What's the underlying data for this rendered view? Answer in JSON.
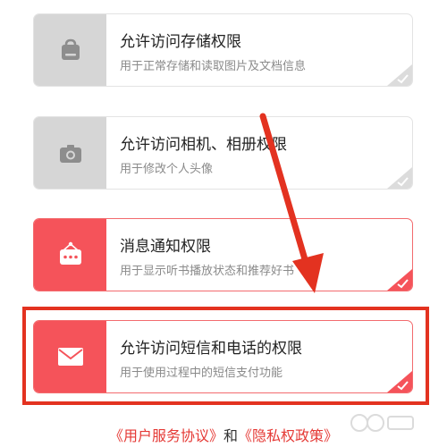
{
  "permissions": [
    {
      "title": "允许访问存储权限",
      "desc": "用于正常存储和读取图片及文档信息",
      "icon": "storage-icon",
      "active": false
    },
    {
      "title": "允许访问相机、相册权限",
      "desc": "用于修改个人头像",
      "icon": "camera-icon",
      "active": false
    },
    {
      "title": "消息通知权限",
      "desc": "用于显示听书播放状态和推荐好书",
      "icon": "notification-icon",
      "active": true
    },
    {
      "title": "允许访问短信和电话的权限",
      "desc": "用于使用过程中的短信支付功能",
      "icon": "mail-icon",
      "active": true
    }
  ],
  "footer": {
    "user_agreement": "《用户服务协议》",
    "separator": "和",
    "privacy_policy": "《隐私权政策》"
  },
  "colors": {
    "accent": "#f5535a",
    "inactive_icon_bg": "#d6d6d6",
    "annotation": "#e33220"
  }
}
